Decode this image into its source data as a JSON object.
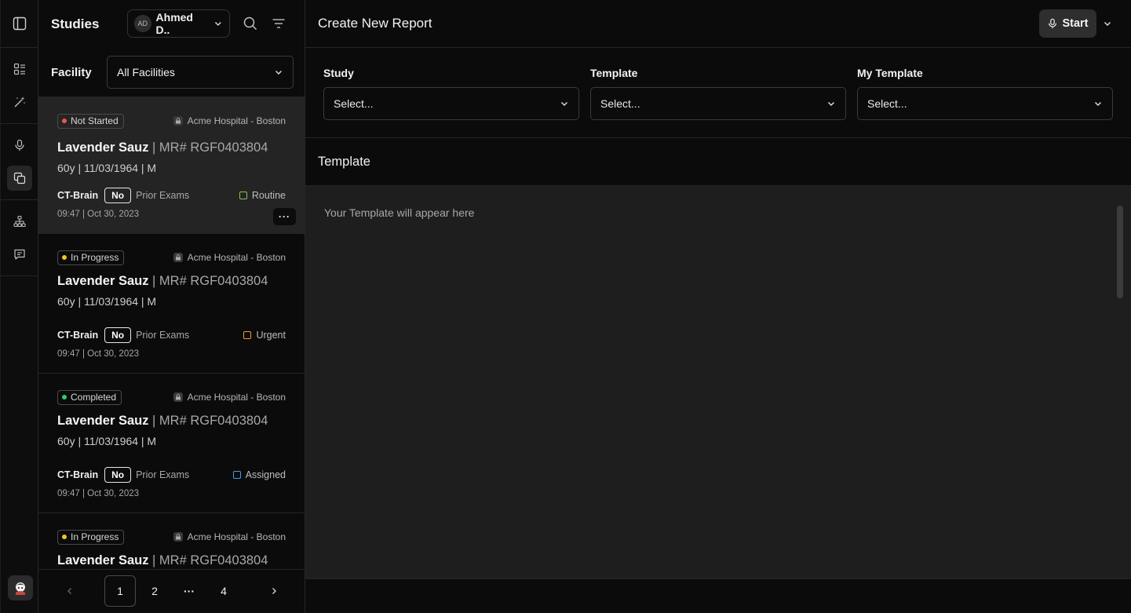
{
  "studies_panel": {
    "title": "Studies",
    "user": {
      "initials": "AD",
      "name": "Ahmed D.."
    },
    "facility_label": "Facility",
    "facility_value": "All Facilities"
  },
  "study_cards": [
    {
      "status": "Not Started",
      "status_color": "#ef5350",
      "hospital": "Acme Hospital - Boston",
      "patient": "Lavender Sauz",
      "mr": " | MR# RGF0403804",
      "demographics": "60y | 11/03/1964 | M",
      "exam": "CT-Brain",
      "prior_flag": "No",
      "prior_label": "Prior Exams",
      "priority": "Routine",
      "priority_color": "#8bc34a",
      "timestamp": "09:47 | Oct 30, 2023",
      "more": "···"
    },
    {
      "status": "In Progress",
      "status_color": "#f5c518",
      "hospital": "Acme Hospital - Boston",
      "patient": "Lavender Sauz",
      "mr": " | MR# RGF0403804",
      "demographics": "60y | 11/03/1964 | M",
      "exam": "CT-Brain",
      "prior_flag": "No",
      "prior_label": "Prior Exams",
      "priority": "Urgent",
      "priority_color": "#f0a020",
      "timestamp": "09:47 | Oct 30, 2023"
    },
    {
      "status": "Completed",
      "status_color": "#2ecc71",
      "hospital": "Acme Hospital - Boston",
      "patient": "Lavender Sauz",
      "mr": " | MR# RGF0403804",
      "demographics": "60y | 11/03/1964 | M",
      "exam": "CT-Brain",
      "prior_flag": "No",
      "prior_label": "Prior Exams",
      "priority": "Assigned",
      "priority_color": "#3f9cf5",
      "timestamp": "09:47 | Oct 30, 2023"
    },
    {
      "status": "In Progress",
      "status_color": "#f5c518",
      "hospital": "Acme Hospital - Boston",
      "patient": "Lavender Sauz",
      "mr": " | MR# RGF0403804"
    }
  ],
  "pagination": {
    "pages": [
      "1",
      "2",
      "···",
      "4"
    ],
    "current": "1"
  },
  "main": {
    "title": "Create New Report",
    "start_label": "Start",
    "selects": [
      {
        "label": "Study",
        "value": "Select..."
      },
      {
        "label": "Template",
        "value": "Select..."
      },
      {
        "label": "My Template",
        "value": "Select..."
      }
    ],
    "template_heading": "Template",
    "template_placeholder": "Your Template will appear here"
  },
  "icons": {
    "rail": [
      "sidebar-toggle-icon",
      "list-icon",
      "magic-wand-icon",
      "microphone-icon",
      "copy-icon",
      "hierarchy-icon",
      "chat-icon",
      "avatar-icon"
    ],
    "header": [
      "search-icon",
      "filter-icon",
      "chevron-down-icon"
    ]
  }
}
